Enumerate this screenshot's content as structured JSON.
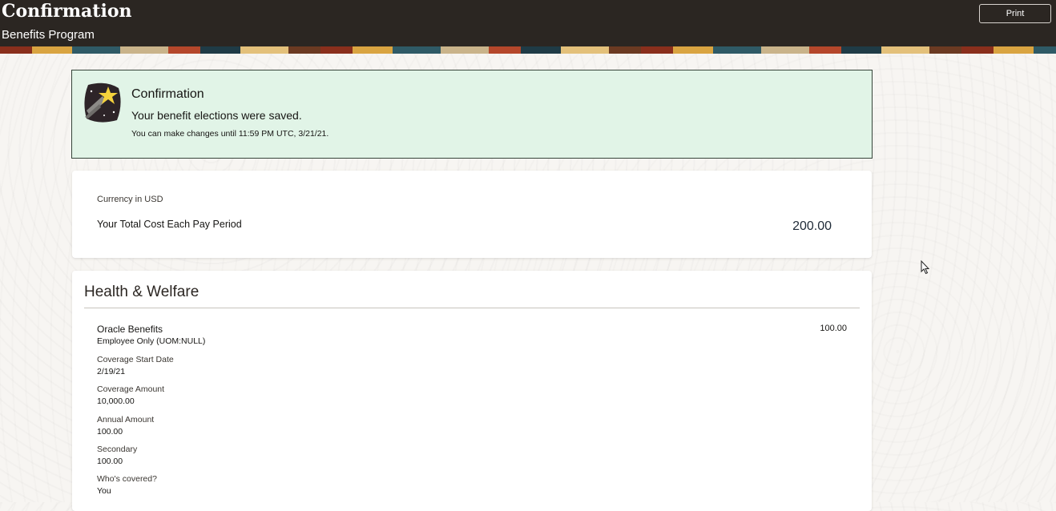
{
  "header": {
    "title": "Confirmation",
    "subtitle": "Benefits Program",
    "print_label": "Print"
  },
  "banner": {
    "icon": "shooting-star-icon",
    "title": "Confirmation",
    "message": "Your benefit elections were saved.",
    "detail": "You can make changes until 11:59 PM UTC, 3/21/21."
  },
  "total": {
    "currency": "Currency in USD",
    "label": "Your Total Cost Each Pay Period",
    "value": "200.00"
  },
  "health": {
    "title": "Health & Welfare",
    "plan": {
      "name": "Oracle Benefits",
      "amount": "100.00",
      "option": "Employee Only (UOM:NULL)",
      "fields": [
        {
          "label": "Coverage Start Date",
          "value": "2/19/21"
        },
        {
          "label": "Coverage Amount",
          "value": "10,000.00"
        },
        {
          "label": "Annual Amount",
          "value": "100.00"
        },
        {
          "label": "Secondary",
          "value": "100.00"
        },
        {
          "label": "Who's covered?",
          "value": "You"
        }
      ]
    }
  },
  "colors": {
    "header_bg": "#2b2622",
    "banner_bg": "#e1f4e7",
    "page_bg": "#f7f5f2"
  }
}
